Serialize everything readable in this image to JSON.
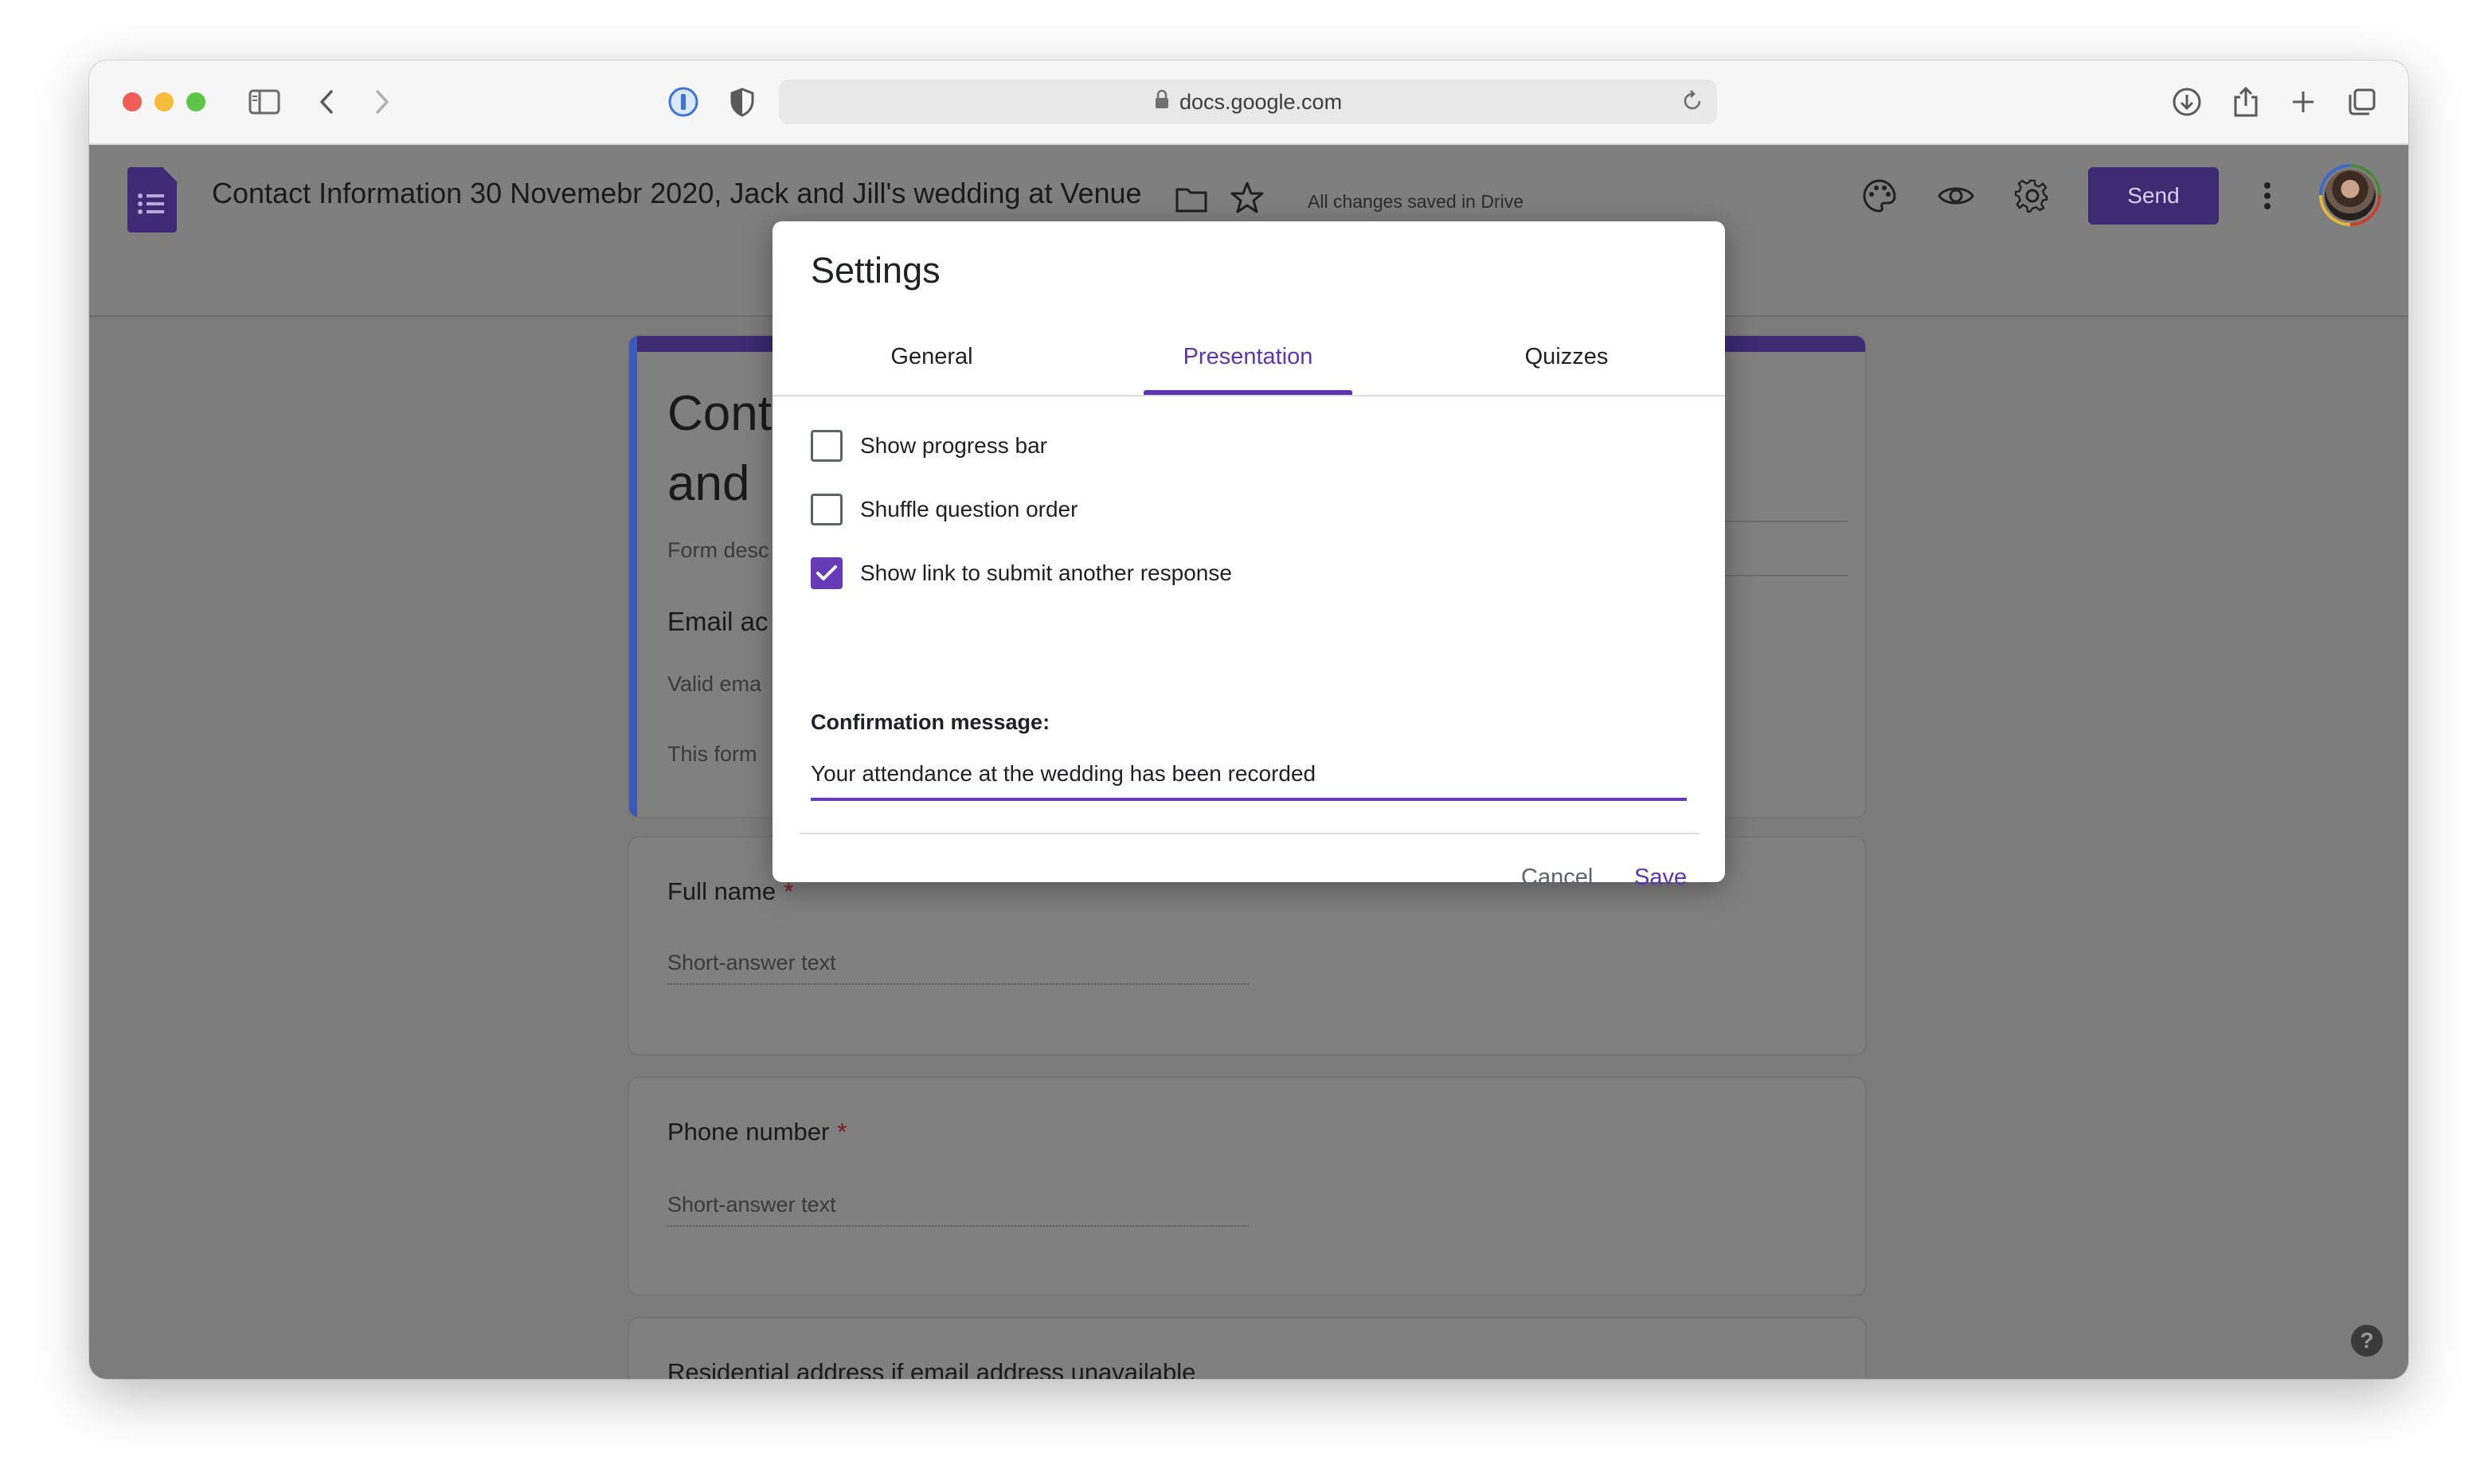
{
  "browser": {
    "url": "docs.google.com"
  },
  "header": {
    "form_title": "Contact Information 30 Novemebr 2020, Jack and Jill's wedding at Venue",
    "saved_status": "All changes saved in Drive",
    "send_label": "Send"
  },
  "form": {
    "title_partial_line1": "Cont",
    "title_partial_line2": "and ",
    "description_partial": "Form desc",
    "email_label_partial": "Email ac",
    "email_placeholder_partial": "Valid ema",
    "collect_note_partial": "This form",
    "questions": [
      {
        "title": "Full name",
        "required_mark": "*",
        "placeholder": "Short-answer text"
      },
      {
        "title": "Phone number",
        "required_mark": "*",
        "placeholder": "Short-answer text"
      },
      {
        "title": "Residential address if email address unavailable"
      }
    ]
  },
  "settings": {
    "title": "Settings",
    "tabs": [
      {
        "label": "General"
      },
      {
        "label": "Presentation",
        "active": true
      },
      {
        "label": "Quizzes"
      }
    ],
    "options": [
      {
        "label": "Show progress bar",
        "checked": false
      },
      {
        "label": "Shuffle question order",
        "checked": false
      },
      {
        "label": "Show link to submit another response",
        "checked": true
      }
    ],
    "confirmation_label": "Confirmation message:",
    "confirmation_value": "Your attendance at the wedding has been recorded",
    "cancel_label": "Cancel",
    "save_label": "Save"
  },
  "help_label": "?",
  "colors": {
    "accent": "#673ab7",
    "send_button": "#3d2a72",
    "overlay": "#7f7f7f"
  }
}
